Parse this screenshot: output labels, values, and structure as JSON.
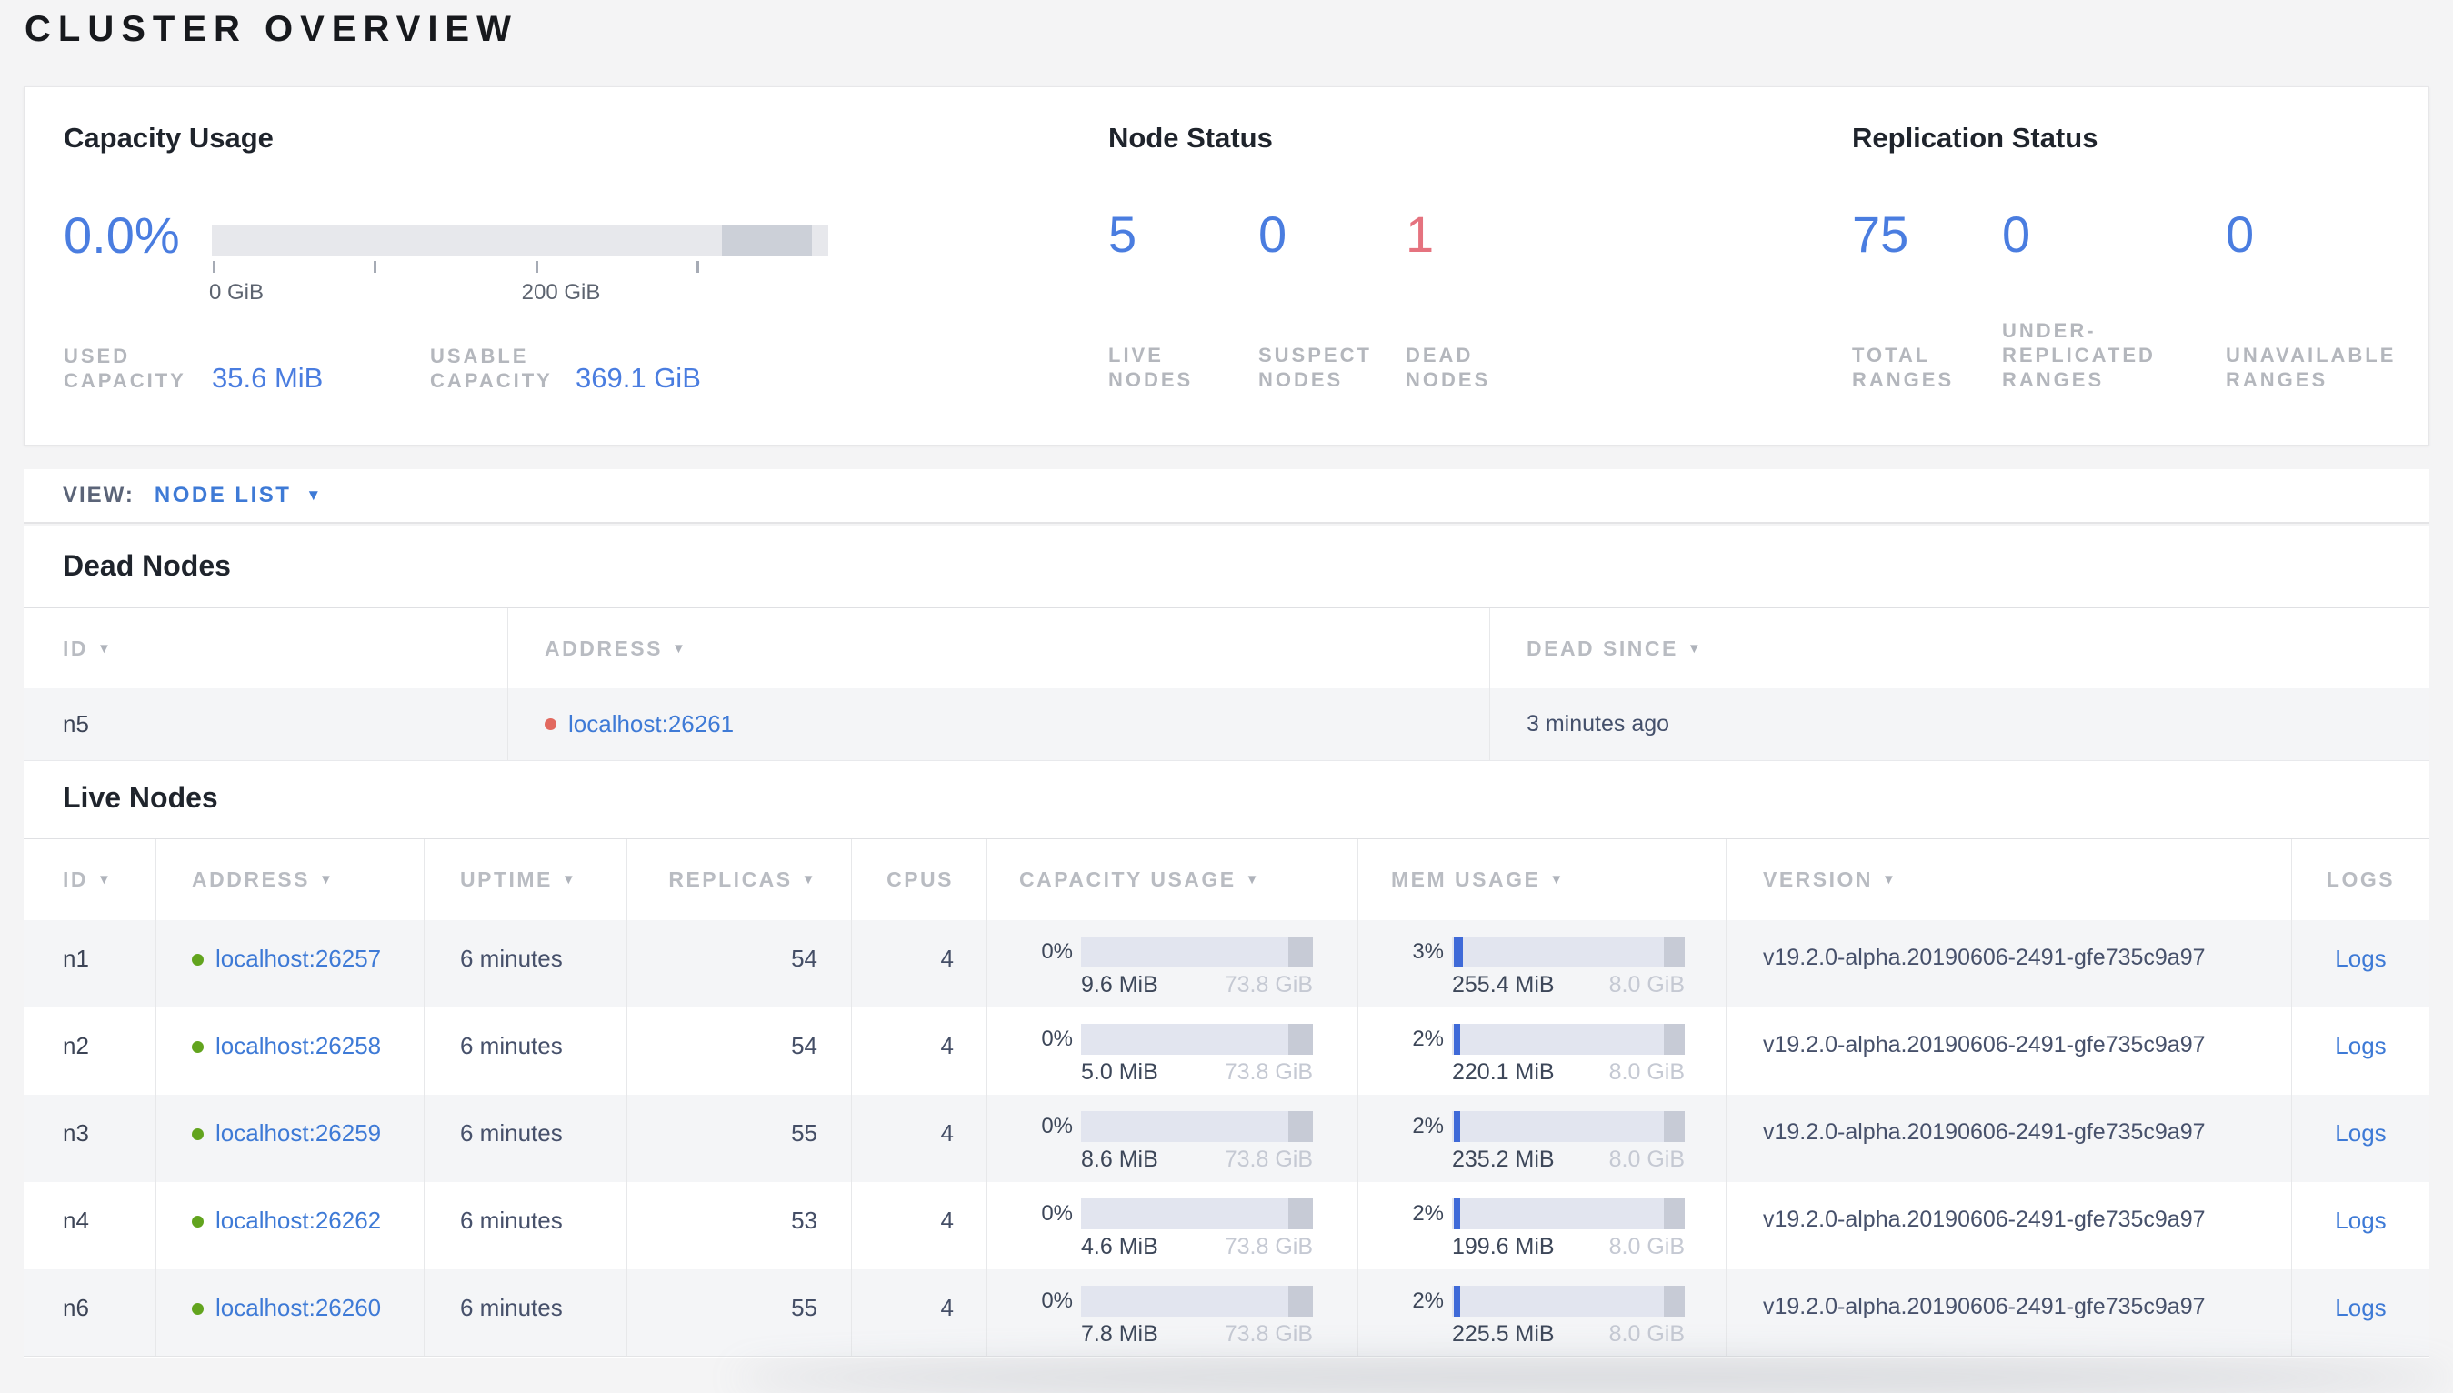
{
  "page": {
    "title": "CLUSTER OVERVIEW"
  },
  "colors": {
    "accent_blue": "#3e7ad6",
    "value_blue": "#4a7de0",
    "danger_red": "#e5737f",
    "live_green_dot": "#62a41e",
    "dead_red_dot": "#e2695f"
  },
  "summary": {
    "capacity": {
      "title": "Capacity Usage",
      "percent": "0.0%",
      "tick_labels": [
        "0 GiB",
        "200 GiB"
      ],
      "used": {
        "label": "USED\nCAPACITY",
        "value": "35.6 MiB"
      },
      "usable": {
        "label": "USABLE\nCAPACITY",
        "value": "369.1 GiB"
      }
    },
    "node_status": {
      "title": "Node Status",
      "stats": [
        {
          "value": "5",
          "label": "LIVE\nNODES"
        },
        {
          "value": "0",
          "label": "SUSPECT\nNODES"
        },
        {
          "value": "1",
          "label": "DEAD\nNODES"
        }
      ]
    },
    "replication": {
      "title": "Replication Status",
      "stats": [
        {
          "value": "75",
          "label": "TOTAL\nRANGES"
        },
        {
          "value": "0",
          "label": "UNDER-\nREPLICATED\nRANGES"
        },
        {
          "value": "0",
          "label": "UNAVAILABLE\nRANGES"
        }
      ]
    }
  },
  "view_bar": {
    "label": "VIEW:",
    "selected": "NODE LIST"
  },
  "dead_nodes": {
    "title": "Dead Nodes",
    "columns": {
      "id": "ID",
      "address": "ADDRESS",
      "dead_since": "DEAD SINCE"
    },
    "rows": [
      {
        "id": "n5",
        "address": "localhost:26261",
        "dead_since": "3 minutes ago"
      }
    ]
  },
  "live_nodes": {
    "title": "Live Nodes",
    "columns": {
      "id": "ID",
      "address": "ADDRESS",
      "uptime": "UPTIME",
      "replicas": "REPLICAS",
      "cpus": "CPUS",
      "capacity_usage": "CAPACITY USAGE",
      "mem_usage": "MEM USAGE",
      "version": "VERSION",
      "logs": "LOGS"
    },
    "logs_label": "Logs",
    "rows": [
      {
        "id": "n1",
        "address": "localhost:26257",
        "uptime": "6 minutes",
        "replicas": "54",
        "cpus": "4",
        "cap_pct": "0%",
        "cap_used": "9.6 MiB",
        "cap_total": "73.8 GiB",
        "mem_pct": "3%",
        "mem_used": "255.4 MiB",
        "mem_total": "8.0 GiB",
        "version": "v19.2.0-alpha.20190606-2491-gfe735c9a97"
      },
      {
        "id": "n2",
        "address": "localhost:26258",
        "uptime": "6 minutes",
        "replicas": "54",
        "cpus": "4",
        "cap_pct": "0%",
        "cap_used": "5.0 MiB",
        "cap_total": "73.8 GiB",
        "mem_pct": "2%",
        "mem_used": "220.1 MiB",
        "mem_total": "8.0 GiB",
        "version": "v19.2.0-alpha.20190606-2491-gfe735c9a97"
      },
      {
        "id": "n3",
        "address": "localhost:26259",
        "uptime": "6 minutes",
        "replicas": "55",
        "cpus": "4",
        "cap_pct": "0%",
        "cap_used": "8.6 MiB",
        "cap_total": "73.8 GiB",
        "mem_pct": "2%",
        "mem_used": "235.2 MiB",
        "mem_total": "8.0 GiB",
        "version": "v19.2.0-alpha.20190606-2491-gfe735c9a97"
      },
      {
        "id": "n4",
        "address": "localhost:26262",
        "uptime": "6 minutes",
        "replicas": "53",
        "cpus": "4",
        "cap_pct": "0%",
        "cap_used": "4.6 MiB",
        "cap_total": "73.8 GiB",
        "mem_pct": "2%",
        "mem_used": "199.6 MiB",
        "mem_total": "8.0 GiB",
        "version": "v19.2.0-alpha.20190606-2491-gfe735c9a97"
      },
      {
        "id": "n6",
        "address": "localhost:26260",
        "uptime": "6 minutes",
        "replicas": "55",
        "cpus": "4",
        "cap_pct": "0%",
        "cap_used": "7.8 MiB",
        "cap_total": "73.8 GiB",
        "mem_pct": "2%",
        "mem_used": "225.5 MiB",
        "mem_total": "8.0 GiB",
        "version": "v19.2.0-alpha.20190606-2491-gfe735c9a97"
      }
    ]
  }
}
